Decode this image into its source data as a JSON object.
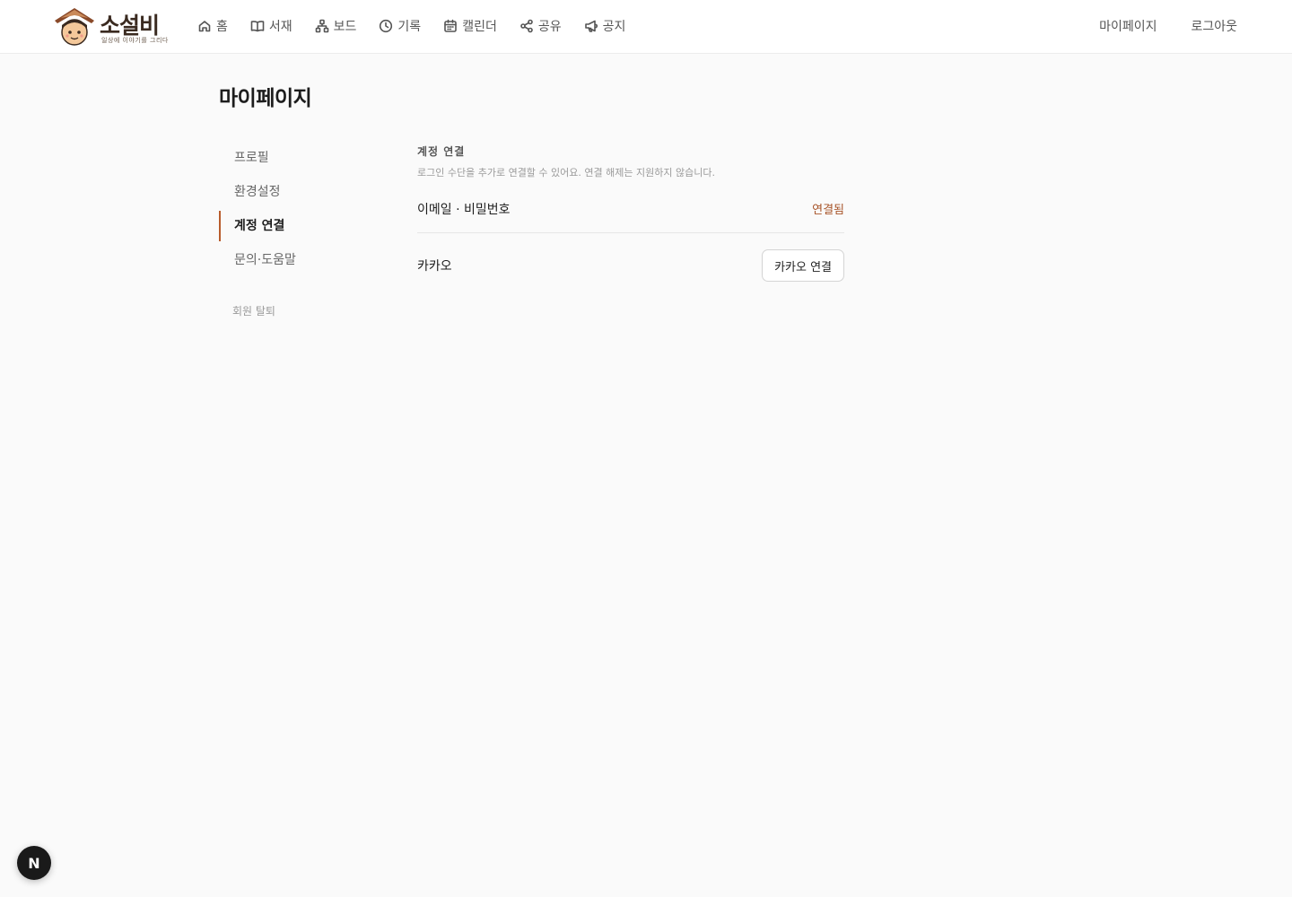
{
  "header": {
    "brand": "소설비",
    "tagline": "일상에 이야기를 그리다",
    "nav": [
      {
        "label": "홈",
        "icon": "home-icon"
      },
      {
        "label": "서재",
        "icon": "book-icon"
      },
      {
        "label": "보드",
        "icon": "board-icon"
      },
      {
        "label": "기록",
        "icon": "clock-icon"
      },
      {
        "label": "캘린더",
        "icon": "calendar-icon"
      },
      {
        "label": "공유",
        "icon": "share-icon"
      },
      {
        "label": "공지",
        "icon": "megaphone-icon"
      }
    ],
    "mypage": "마이페이지",
    "logout": "로그아웃"
  },
  "page": {
    "title": "마이페이지",
    "menu": [
      "프로필",
      "환경설정",
      "계정 연결",
      "문의·도움말"
    ],
    "active_menu": "계정 연결",
    "withdraw": "회원 탈퇴"
  },
  "section": {
    "title": "계정 연결",
    "description": "로그인 수단을 추가로 연결할 수 있어요. 연결 해제는 지원하지 않습니다.",
    "email_label": "이메일 · 비밀번호",
    "email_status": "연결됨",
    "kakao_label": "카카오",
    "kakao_button": "카카오 연결"
  },
  "badge": "N",
  "colors": {
    "accent": "#b85c2c",
    "status": "#a8552a"
  }
}
